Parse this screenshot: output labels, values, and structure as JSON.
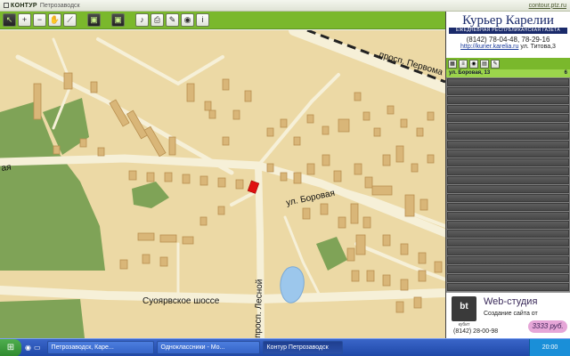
{
  "header": {
    "brand": "КОНТУР",
    "city": "Петрозаводск",
    "site_url": "contour.ptz.ru"
  },
  "toolbar": {
    "tools": [
      "pointer-tool",
      "zoom-in-tool",
      "zoom-out-tool",
      "hand-tool",
      "ruler-tool",
      "layers-tool",
      "satellite-tool",
      "mic-tool",
      "print-tool",
      "save-tool",
      "photo-tool",
      "info-tool"
    ],
    "glyphs": [
      "↖",
      "+",
      "−",
      "✋",
      "⟋",
      "▣",
      "▣",
      "♪",
      "⎙",
      "✎",
      "◉",
      "i"
    ]
  },
  "map": {
    "labels": {
      "pervomaisky": "просп. Первома",
      "borovaya": "ул. Боровая",
      "suoyarvskoe": "Суоярвское шоссе",
      "lesnoy": "просп. Лесной",
      "left_fragment": "ая"
    },
    "colors": {
      "land": "#ecd9a5",
      "road": "#f6f0d8",
      "building": "#d9b678",
      "park": "#7fa357",
      "water": "#9cc7ec",
      "marker": "#e01010"
    }
  },
  "side_panel": {
    "ad1": {
      "title": "Курьер Карелии",
      "subtitle": "ЕЖЕДНЕВНАЯ РЕСПУБЛИКАНСКАЯ ГАЗЕТА",
      "phone": "(8142) 78-04-48, 78-29-16",
      "url": "http://kurier.karelia.ru",
      "address": "ул. Титова,3"
    },
    "result_header": "ул. Боровая, 13",
    "result_count": "6",
    "ad2": {
      "logo": "bt",
      "logo_caption": "кубит",
      "title": "Web-студия",
      "text": "Создание сайта от",
      "price": "3333 руб.",
      "phone": "(8142) 28-00-98"
    }
  },
  "taskbar": {
    "tasks": [
      "Петрозаводск, Каре...",
      "Одноклассники - Мо...",
      "Контур Петрозаводск"
    ],
    "clock": "20:00"
  }
}
